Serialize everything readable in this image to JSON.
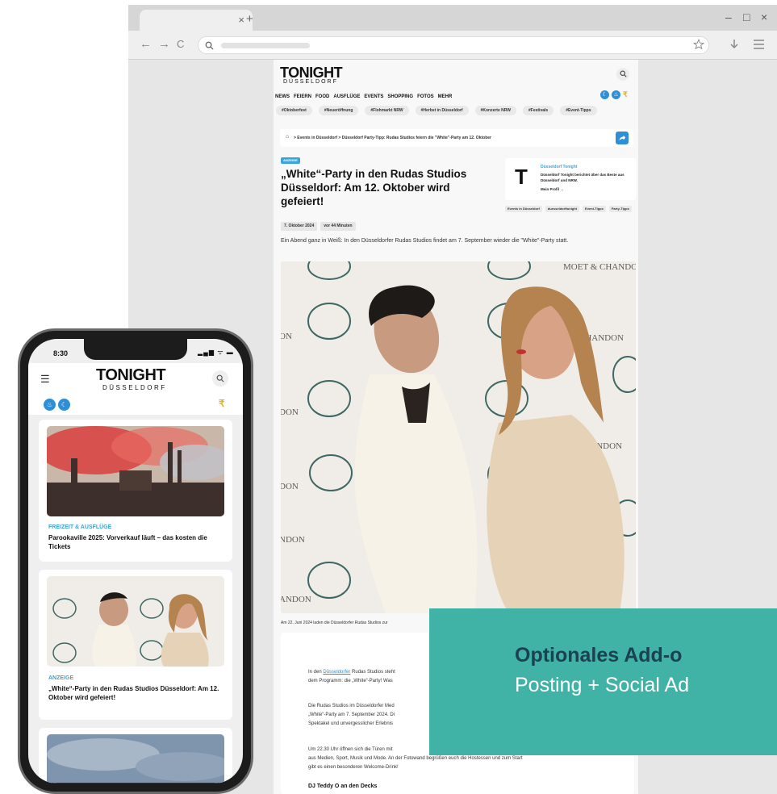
{
  "browser": {
    "tab_close": "×",
    "new_tab": "+",
    "win_min": "–",
    "win_max": "□",
    "win_close": "×",
    "nav_back": "←",
    "nav_forward": "→",
    "nav_reload": "C",
    "omnibox_icon": "search-icon",
    "bookmark_icon": "star-icon",
    "download_icon": "download-icon",
    "menu_icon": "menu-icon"
  },
  "site": {
    "logo": "TONIGHT",
    "logo_sub": "DÜSSELDORF",
    "nav": [
      "NEWS",
      "FEIERN",
      "FOOD",
      "AUSFLÜGE",
      "EVENTS",
      "SHOPPING",
      "FOTOS",
      "MEHR"
    ],
    "chips": [
      "#Oktoberfest",
      "#Neueröffnung",
      "#Flohmarkt NRW",
      "#Herbst in Düsseldorf",
      "#Konzerte NRW",
      "#Festivals",
      "#Event-Tipps"
    ],
    "breadcrumb": "> Events in Düsseldorf > Düsseldorf Party-Tipp: Rudas Studios feiern die \"White\"-Party am 12. Oktober",
    "badge": "ANZEIGE",
    "headline": "„White“-Party in den Rudas Studios Düsseldorf: Am 12. Oktober wird gefeiert!",
    "author": {
      "name": "Düsseldorf Tonight",
      "desc": "Düsseldorf Tonight berichtet über das Beste aus Düsseldorf und NRW.",
      "link": "Mein Profil →"
    },
    "tags": [
      "Events in Düsseldorf",
      "duesseldorftonight",
      "Event-Tipps",
      "Party-Tipps"
    ],
    "date": "7. Oktober 2024",
    "ago": "vor 44 Minuten",
    "lead": "Ein Abend ganz in Weiß: In den Düsseldorfer Rudas Studios findet am 7. September wieder die \"White\"-Party statt.",
    "caption": "Am 22. Juni 2024 laden die Düsseldorfer Rudas Studios zur",
    "para1_a": "In den ",
    "para1_link": "Düsseldorfer",
    "para1_b": " Rudas Studios steht",
    "para1_c": "dem Programm: die „White“-Party! Was",
    "para2_a": "Die Rudas Studios im Düsseldorfer Med",
    "para2_b": "„White“-Party am 7. September 2024. Di",
    "para2_c": "Spektakel und unvergesslicher Erlebnis",
    "para3_a": "Um 22.30 Uhr öffnen sich die Türen mit",
    "para3_b": "aus Medien, Sport, Musik und Mode. An der Fotowand begrüßen euch die Hostessen und zum Start",
    "para3_c": "gibt es einen besonderen Welcome-Drink!",
    "subhead": "DJ Teddy O an den Decks"
  },
  "addon": {
    "title": "Optionales Add-o",
    "subtitle": "Posting + Social Ad"
  },
  "phone": {
    "time": "8:30",
    "status": "▂▄▆ ᯤ ▬",
    "menu": "☰",
    "logo": "TONIGHT",
    "logo_sub": "DÜSSELDORF",
    "r": "₹",
    "cards": [
      {
        "category": "FREIZEIT & AUSFLÜGE",
        "title": "Parookaville 2025: Vorverkauf läuft – das kosten die Tickets"
      },
      {
        "category": "ANZEIGE",
        "title": "„White“-Party in den Rudas Studios Düsseldorf: Am 12. Oktober wird gefeiert!"
      }
    ]
  },
  "colors": {
    "accent": "#3aa5d8",
    "addon_bg": "#40b3a6",
    "addon_title": "#1c4150",
    "mode_yellow": "#e8b31a"
  }
}
